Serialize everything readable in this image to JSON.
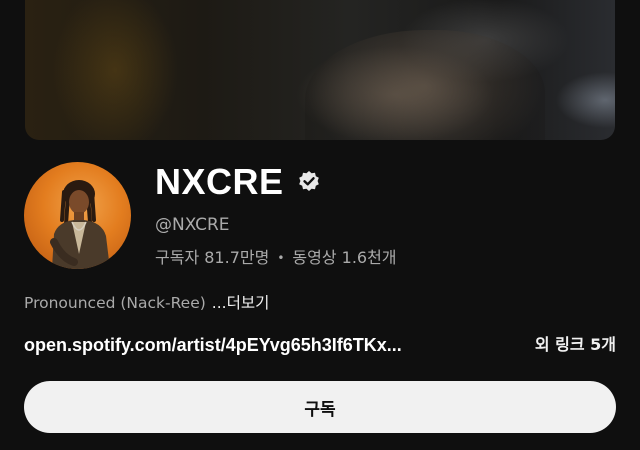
{
  "channel": {
    "name": "NXCRE",
    "handle": "@NXCRE",
    "verified_icon": "verified-badge-icon",
    "subscribers": "구독자 81.7만명",
    "separator": "•",
    "videos": "동영상 1.6천개"
  },
  "description": {
    "text": "Pronounced (Nack-Ree)",
    "more_label": "...더보기"
  },
  "links": {
    "url": "open.spotify.com/artist/4pEYvg65h3If6TKx...",
    "more_links": "외 링크 5개"
  },
  "actions": {
    "subscribe_label": "구독"
  },
  "colors": {
    "background": "#0f0f0f",
    "primary_text": "#ffffff",
    "secondary_text": "#aaaaaa",
    "subscribe_bg": "#f1f1f1",
    "avatar_accent": "#e37d1f"
  }
}
